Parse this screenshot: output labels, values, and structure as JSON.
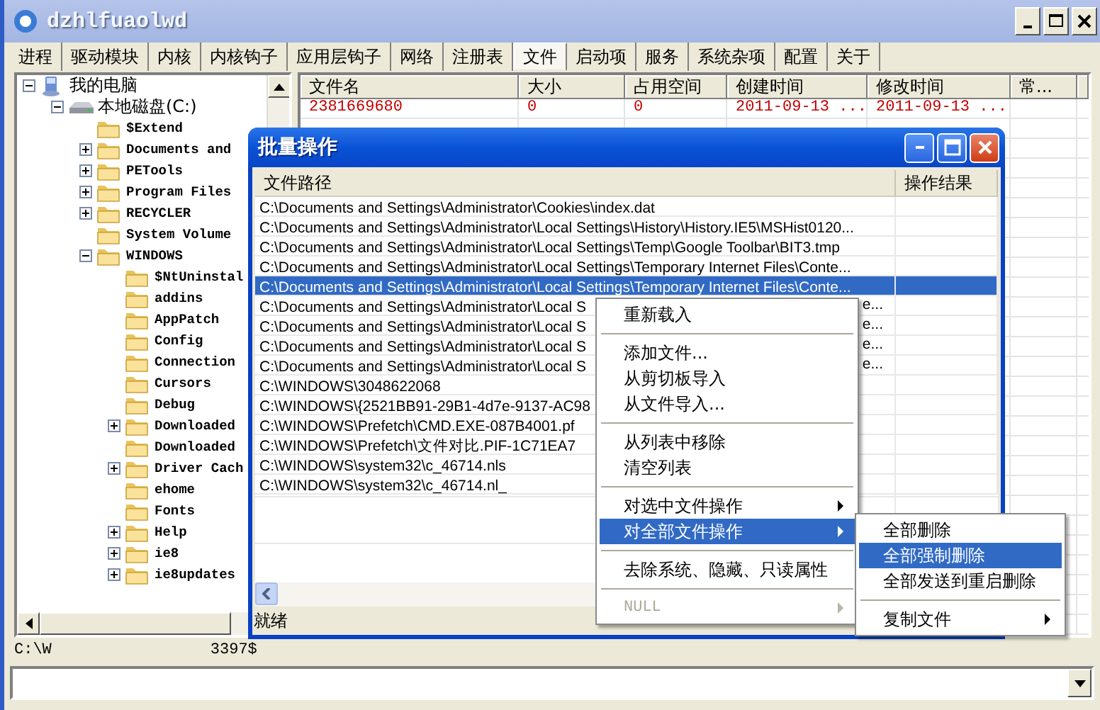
{
  "window": {
    "title": "dzhlfuaolwd"
  },
  "tabs": [
    {
      "label": "进程",
      "selected": false
    },
    {
      "label": "驱动模块",
      "selected": false
    },
    {
      "label": "内核",
      "selected": false
    },
    {
      "label": "内核钩子",
      "selected": false
    },
    {
      "label": "应用层钩子",
      "selected": false
    },
    {
      "label": "网络",
      "selected": false
    },
    {
      "label": "注册表",
      "selected": false
    },
    {
      "label": "文件",
      "selected": true
    },
    {
      "label": "启动项",
      "selected": false
    },
    {
      "label": "服务",
      "selected": false
    },
    {
      "label": "系统杂项",
      "selected": false
    },
    {
      "label": "配置",
      "selected": false
    },
    {
      "label": "关于",
      "selected": false
    }
  ],
  "tree": [
    {
      "label": "我的电脑",
      "kind": "computer",
      "expandable": true,
      "expanded": true,
      "children": [
        {
          "label": "本地磁盘(C:)",
          "kind": "drive",
          "expandable": true,
          "expanded": true,
          "children": [
            {
              "label": "$Extend",
              "kind": "folder",
              "expandable": false
            },
            {
              "label": "Documents and",
              "kind": "folder",
              "expandable": true,
              "expanded": false
            },
            {
              "label": "PETools",
              "kind": "folder",
              "expandable": true,
              "expanded": false
            },
            {
              "label": "Program Files",
              "kind": "folder",
              "expandable": true,
              "expanded": false
            },
            {
              "label": "RECYCLER",
              "kind": "folder",
              "expandable": true,
              "expanded": false
            },
            {
              "label": "System Volume",
              "kind": "folder",
              "expandable": false
            },
            {
              "label": "WINDOWS",
              "kind": "folder",
              "expandable": true,
              "expanded": true,
              "children": [
                {
                  "label": "$NtUninstal",
                  "kind": "folder",
                  "expandable": false
                },
                {
                  "label": "addins",
                  "kind": "folder",
                  "expandable": false
                },
                {
                  "label": "AppPatch",
                  "kind": "folder",
                  "expandable": false
                },
                {
                  "label": "Config",
                  "kind": "folder",
                  "expandable": false
                },
                {
                  "label": "Connection",
                  "kind": "folder",
                  "expandable": false
                },
                {
                  "label": "Cursors",
                  "kind": "folder",
                  "expandable": false
                },
                {
                  "label": "Debug",
                  "kind": "folder",
                  "expandable": false
                },
                {
                  "label": "Downloaded",
                  "kind": "folder",
                  "expandable": true,
                  "expanded": false
                },
                {
                  "label": "Downloaded",
                  "kind": "folder",
                  "expandable": false
                },
                {
                  "label": "Driver Cach",
                  "kind": "folder",
                  "expandable": true,
                  "expanded": false
                },
                {
                  "label": "ehome",
                  "kind": "folder",
                  "expandable": false
                },
                {
                  "label": "Fonts",
                  "kind": "folder",
                  "expandable": false
                },
                {
                  "label": "Help",
                  "kind": "folder",
                  "expandable": true,
                  "expanded": false
                },
                {
                  "label": "ie8",
                  "kind": "folder",
                  "expandable": true,
                  "expanded": false
                },
                {
                  "label": "ie8updates",
                  "kind": "folder",
                  "expandable": true,
                  "expanded": false
                }
              ]
            }
          ]
        }
      ]
    }
  ],
  "file_table": {
    "columns": [
      "文件名",
      "大小",
      "占用空间",
      "创建时间",
      "修改时间",
      "常..."
    ],
    "rows": [
      {
        "cells": [
          "2381669680",
          "0",
          "0",
          "2011-09-13 ...",
          "2011-09-13 ..."
        ]
      }
    ]
  },
  "dialog": {
    "title": "批量操作",
    "columns": [
      "文件路径",
      "操作结果"
    ],
    "rows": [
      {
        "path": "C:\\Documents and Settings\\Administrator\\Cookies\\index.dat",
        "selected": false
      },
      {
        "path": "C:\\Documents and Settings\\Administrator\\Local Settings\\History\\History.IE5\\MSHist0120...",
        "selected": false
      },
      {
        "path": "C:\\Documents and Settings\\Administrator\\Local Settings\\Temp\\Google Toolbar\\BIT3.tmp",
        "selected": false
      },
      {
        "path": "C:\\Documents and Settings\\Administrator\\Local Settings\\Temporary Internet Files\\Conte...",
        "selected": false
      },
      {
        "path": "C:\\Documents and Settings\\Administrator\\Local Settings\\Temporary Internet Files\\Conte...",
        "selected": true
      },
      {
        "path": "C:\\Documents and Settings\\Administrator\\Local S",
        "tail": "e...",
        "selected": false
      },
      {
        "path": "C:\\Documents and Settings\\Administrator\\Local S",
        "tail": "e...",
        "selected": false
      },
      {
        "path": "C:\\Documents and Settings\\Administrator\\Local S",
        "tail": "e...",
        "selected": false
      },
      {
        "path": "C:\\Documents and Settings\\Administrator\\Local S",
        "tail": "e...",
        "selected": false
      },
      {
        "path": "C:\\WINDOWS\\3048622068",
        "selected": false
      },
      {
        "path": "C:\\WINDOWS\\{2521BB91-29B1-4d7e-9137-AC98",
        "selected": false
      },
      {
        "path": "C:\\WINDOWS\\Prefetch\\CMD.EXE-087B4001.pf",
        "selected": false
      },
      {
        "path": "C:\\WINDOWS\\Prefetch\\文件对比.PIF-1C71EA7",
        "selected": false
      },
      {
        "path": "C:\\WINDOWS\\system32\\c_46714.nls",
        "selected": false
      },
      {
        "path": "C:\\WINDOWS\\system32\\c_46714.nl_",
        "selected": false
      }
    ],
    "status": "就绪"
  },
  "context_menu": {
    "items": [
      {
        "kind": "item",
        "label": "重新载入",
        "selected": false,
        "submenu": false,
        "disabled": false
      },
      {
        "kind": "separator"
      },
      {
        "kind": "item",
        "label": "添加文件...",
        "selected": false,
        "submenu": false,
        "disabled": false
      },
      {
        "kind": "item",
        "label": "从剪切板导入",
        "selected": false,
        "submenu": false,
        "disabled": false
      },
      {
        "kind": "item",
        "label": "从文件导入...",
        "selected": false,
        "submenu": false,
        "disabled": false
      },
      {
        "kind": "separator"
      },
      {
        "kind": "item",
        "label": "从列表中移除",
        "selected": false,
        "submenu": false,
        "disabled": false
      },
      {
        "kind": "item",
        "label": "清空列表",
        "selected": false,
        "submenu": false,
        "disabled": false
      },
      {
        "kind": "separator"
      },
      {
        "kind": "item",
        "label": "对选中文件操作",
        "selected": false,
        "submenu": true,
        "disabled": false
      },
      {
        "kind": "item",
        "label": "对全部文件操作",
        "selected": true,
        "submenu": true,
        "disabled": false
      },
      {
        "kind": "separator"
      },
      {
        "kind": "item",
        "label": "去除系统、隐藏、只读属性",
        "selected": false,
        "submenu": false,
        "disabled": false
      },
      {
        "kind": "separator"
      },
      {
        "kind": "item",
        "label": "NULL",
        "selected": false,
        "submenu": true,
        "disabled": true
      }
    ]
  },
  "submenu": {
    "items": [
      {
        "kind": "item",
        "label": "全部删除",
        "selected": false,
        "submenu": false,
        "disabled": false
      },
      {
        "kind": "item",
        "label": "全部强制删除",
        "selected": true,
        "submenu": false,
        "disabled": false
      },
      {
        "kind": "item",
        "label": "全部发送到重启删除",
        "selected": false,
        "submenu": false,
        "disabled": false
      },
      {
        "kind": "separator"
      },
      {
        "kind": "item",
        "label": "复制文件",
        "selected": false,
        "submenu": true,
        "disabled": false
      }
    ]
  },
  "status_bar": {
    "texts": [
      "C:\\W",
      "3397$"
    ]
  }
}
